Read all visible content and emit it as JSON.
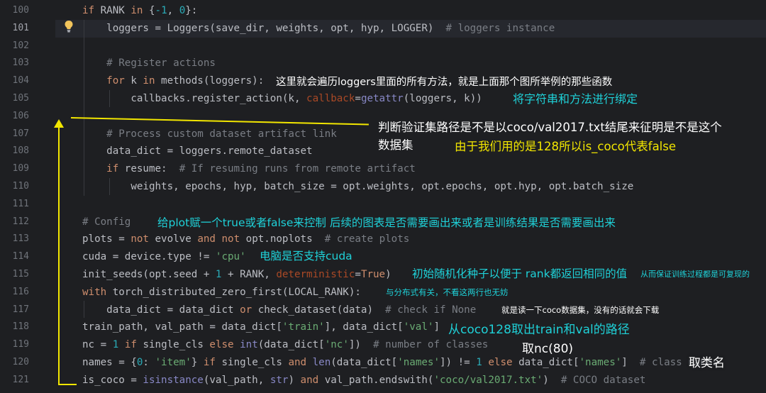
{
  "line_numbers": [
    "100",
    "101",
    "102",
    "103",
    "104",
    "105",
    "106",
    "107",
    "108",
    "109",
    "110",
    "111",
    "112",
    "113",
    "114",
    "115",
    "116",
    "117",
    "118",
    "119",
    "120",
    "121"
  ],
  "code": {
    "l100": [
      "if",
      " RANK ",
      "in",
      " {",
      "-1",
      ", ",
      "0",
      "}:"
    ],
    "l101": [
      "    loggers = ",
      "Loggers",
      "(save_dir, weights, opt, hyp, LOGGER)  ",
      "# loggers instance"
    ],
    "l103": [
      "    # Register actions"
    ],
    "l104": [
      "    ",
      "for",
      " k ",
      "in",
      " methods(loggers):"
    ],
    "l105": [
      "        callbacks.register_action(k, ",
      "callback",
      "=",
      "getattr",
      "(loggers, k))"
    ],
    "l107": [
      "    # Process custom dataset artifact link"
    ],
    "l108": [
      "    data_dict = loggers.remote_dataset"
    ],
    "l109": [
      "    ",
      "if",
      " resume:  ",
      "# If resuming runs from remote artifact"
    ],
    "l110": [
      "        weights, epochs, hyp, batch_size = opt.weights, opt.epochs, opt.hyp, opt.batch_size"
    ],
    "l112": [
      "# Config"
    ],
    "l113": [
      "plots = ",
      "not",
      " evolve ",
      "and",
      " ",
      "not",
      " opt.noplots  ",
      "# create plots"
    ],
    "l114": [
      "cuda = device.type != ",
      "'cpu'"
    ],
    "l115": [
      "init_seeds(opt.seed + ",
      "1",
      " + RANK, ",
      "deterministic",
      "=",
      "True",
      ")"
    ],
    "l116": [
      "with",
      " torch_distributed_zero_first(LOCAL_RANK):"
    ],
    "l117": [
      "    data_dict = data_dict ",
      "or",
      " check_dataset(data)  ",
      "# check if None"
    ],
    "l118": [
      "train_path, val_path = data_dict[",
      "'train'",
      "], data_dict[",
      "'val'",
      "]"
    ],
    "l119": [
      "nc = ",
      "1",
      " ",
      "if",
      " single_cls ",
      "else",
      " ",
      "int",
      "(data_dict[",
      "'nc'",
      "])  ",
      "# number of classes"
    ],
    "l120": [
      "names = {",
      "0",
      ": ",
      "'item'",
      "} ",
      "if",
      " single_cls ",
      "and",
      " ",
      "len",
      "(data_dict[",
      "'names'",
      "]) != ",
      "1",
      " ",
      "else",
      " data_dict[",
      "'names'",
      "]  ",
      "# class names"
    ],
    "l121": [
      "is_coco = ",
      "isinstance",
      "(val_path, ",
      "str",
      ") ",
      "and",
      " val_path.endswith(",
      "'coco/val2017.txt'",
      ")  ",
      "# COCO dataset"
    ]
  },
  "annotations": {
    "a104": "这里就会遍历loggers里面的所有方法，就是上面那个图所举例的那些函数",
    "a105": "将字符串和方法进行绑定",
    "a107a": "判断验证集路径是不是以coco/val2017.txt结尾来征明是不是这个",
    "a107b": "数据集",
    "a108": "由于我们用的是128所以is_coco代表false",
    "a112": "给plot赋一个true或者false来控制 后续的图表是否需要画出来或者是训练结果是否需要画出来",
    "a114": "电脑是否支持cuda",
    "a115a": "初始随机化种子以便于 rank都返回相同的值",
    "a115b": "从而保证训练过程都是可复现的",
    "a116": "与分布式有关，不看这两行也无妨",
    "a117": "就是读一下coco数据集，没有的话就会下载",
    "a118": "从coco128取出train和val的路径",
    "a119": "取nc(80)",
    "a120": "取类名"
  },
  "colors": {
    "background": "#1e1f22",
    "keyword": "#cf8e6d",
    "string": "#6aab73",
    "number": "#2aacb8",
    "comment": "#7a7e85",
    "annotation_cyan": "#1fd1d8",
    "annotation_yellow": "#f2e600"
  },
  "icons": {
    "bulb": "lightbulb-icon"
  }
}
